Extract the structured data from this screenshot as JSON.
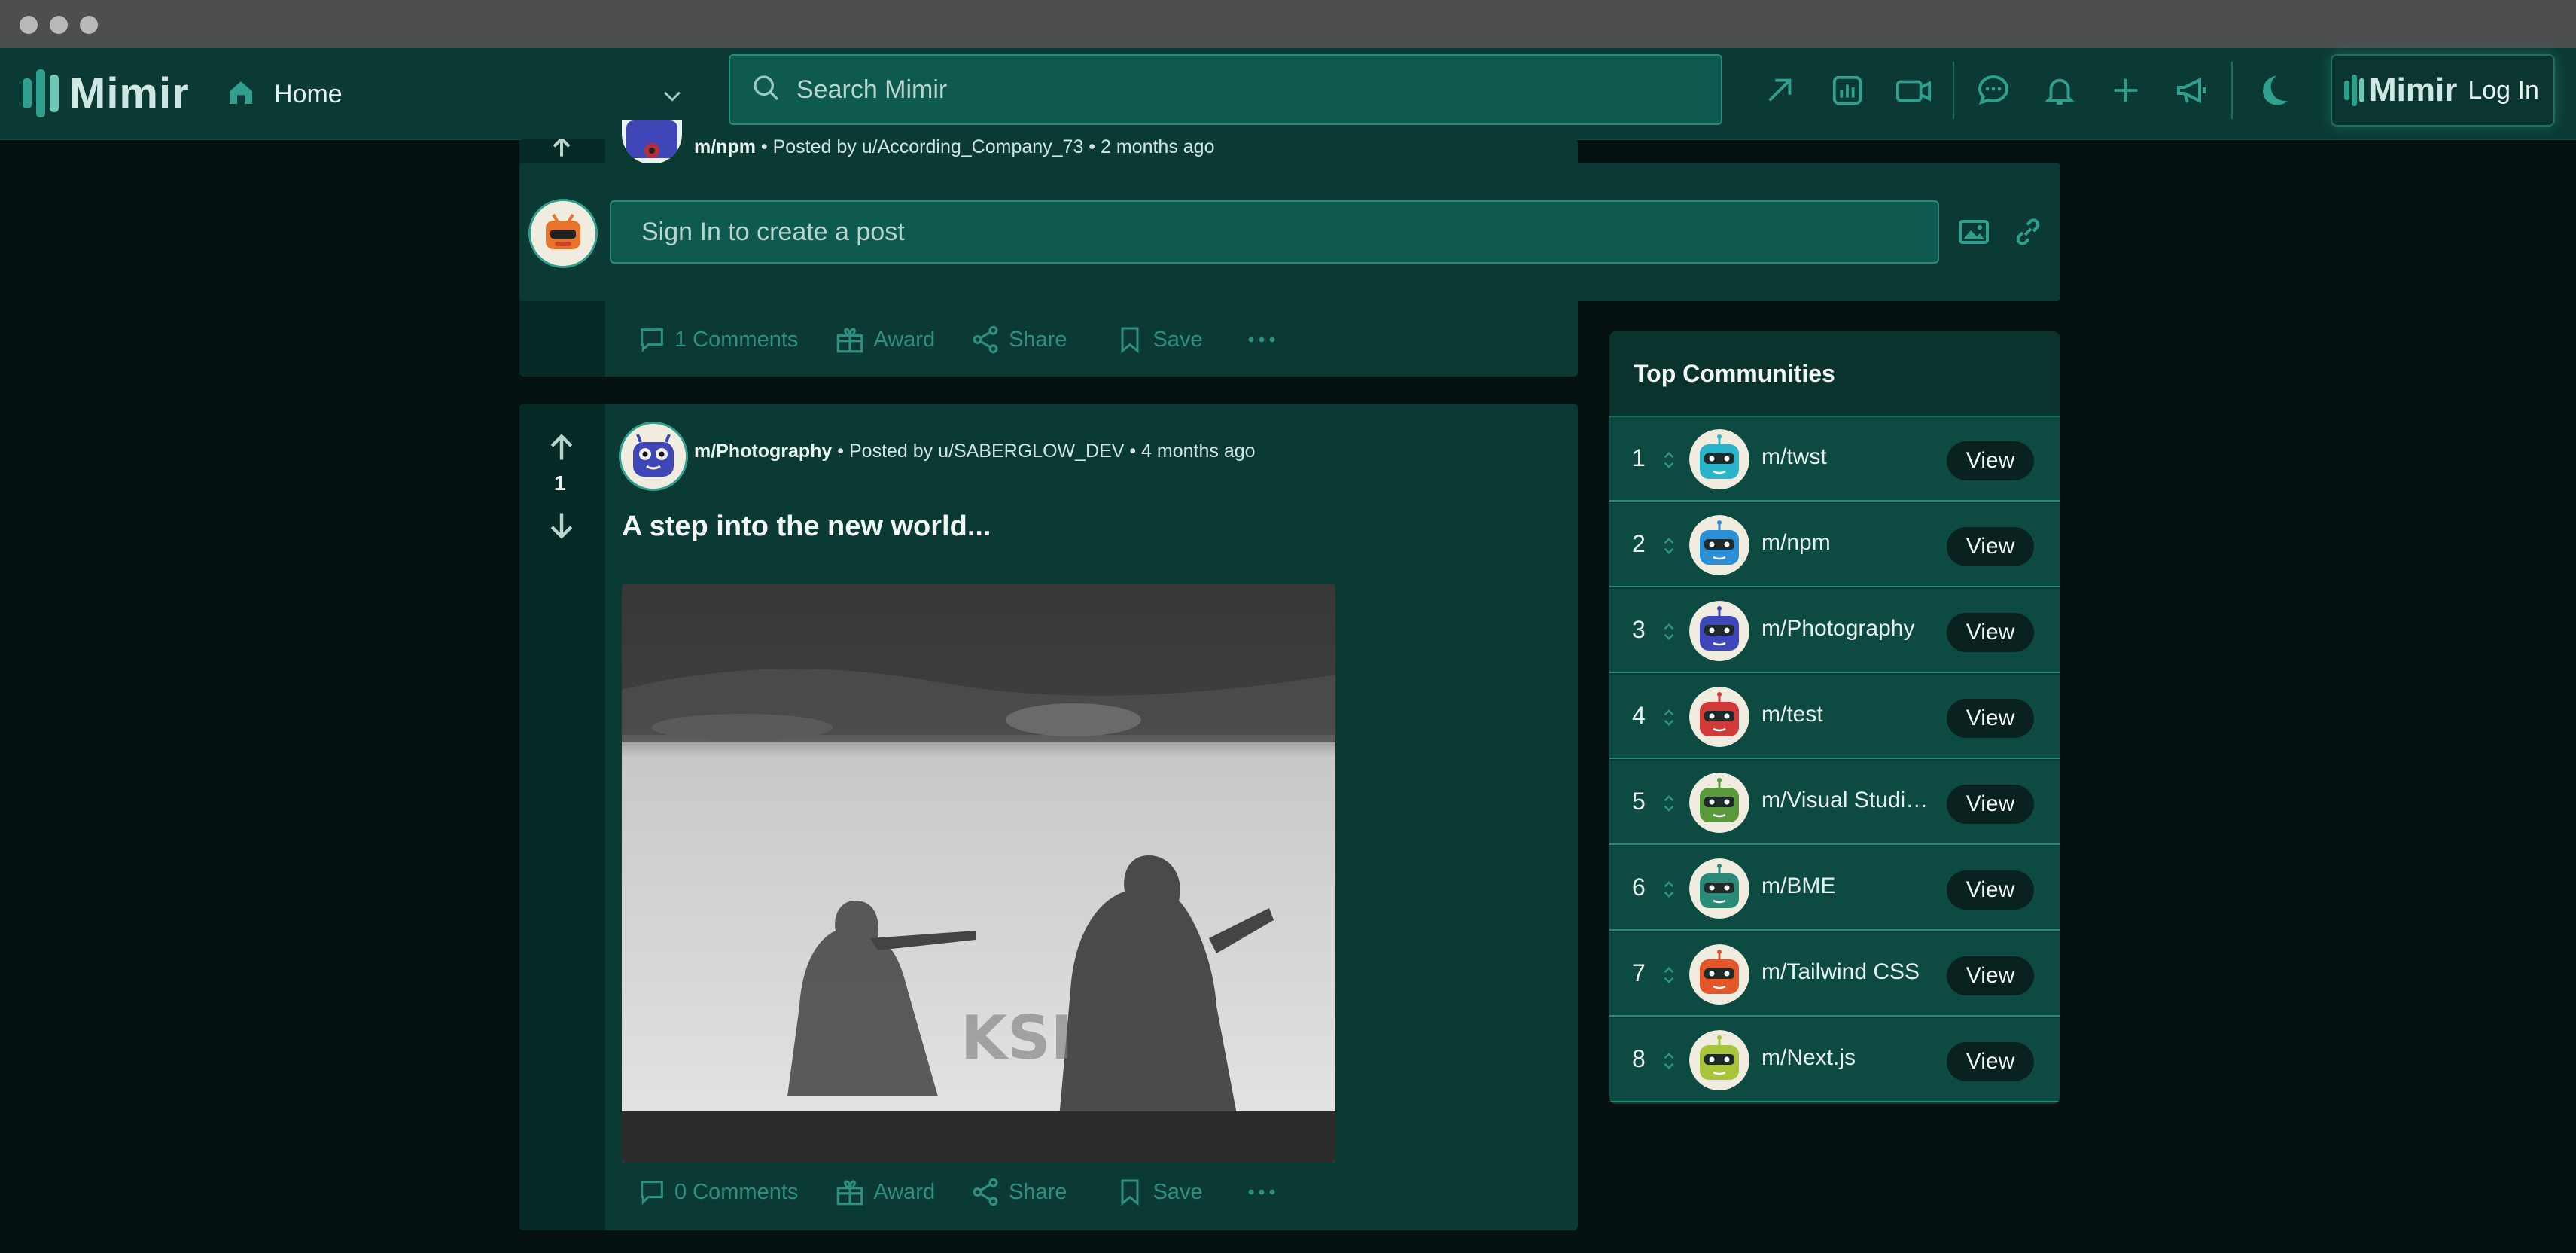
{
  "app": {
    "title": "Mimir"
  },
  "nav": {
    "home_label": "Home",
    "search_placeholder": "Search Mimir",
    "login_logo": "Mimir",
    "login_label": "Log In",
    "icons": [
      "arrow-up-right-icon",
      "stats-icon",
      "video-icon",
      "chat-icon",
      "bell-icon",
      "plus-icon",
      "megaphone-icon",
      "moon-icon"
    ]
  },
  "create_post": {
    "placeholder": "Sign In to create a post"
  },
  "posts": [
    {
      "community": "m/npm",
      "meta": "• Posted by u/According_Company_73 • 2 months ago",
      "actions": {
        "comments": "1 Comments",
        "award": "Award",
        "share": "Share",
        "save": "Save"
      }
    },
    {
      "community": "m/Photography",
      "meta": "• Posted by u/SABERGLOW_DEV • 4 months ago",
      "votes": "1",
      "title": "A step into the new world...",
      "actions": {
        "comments": "0 Comments",
        "award": "Award",
        "share": "Share",
        "save": "Save"
      }
    }
  ],
  "sidebar": {
    "title": "Top Communities",
    "view_label": "View",
    "communities": [
      {
        "rank": "1",
        "name": "m/twst",
        "color": "#2bb3c9"
      },
      {
        "rank": "2",
        "name": "m/npm",
        "color": "#2b8fd6"
      },
      {
        "rank": "3",
        "name": "m/Photography",
        "color": "#3f47b8"
      },
      {
        "rank": "4",
        "name": "m/test",
        "color": "#d23a3a"
      },
      {
        "rank": "5",
        "name": "m/Visual Studio Code",
        "color": "#5a9a3a"
      },
      {
        "rank": "6",
        "name": "m/BME",
        "color": "#2a8a7a"
      },
      {
        "rank": "7",
        "name": "m/Tailwind CSS",
        "color": "#e2562a"
      },
      {
        "rank": "8",
        "name": "m/Next.js",
        "color": "#a8c43a"
      }
    ]
  }
}
